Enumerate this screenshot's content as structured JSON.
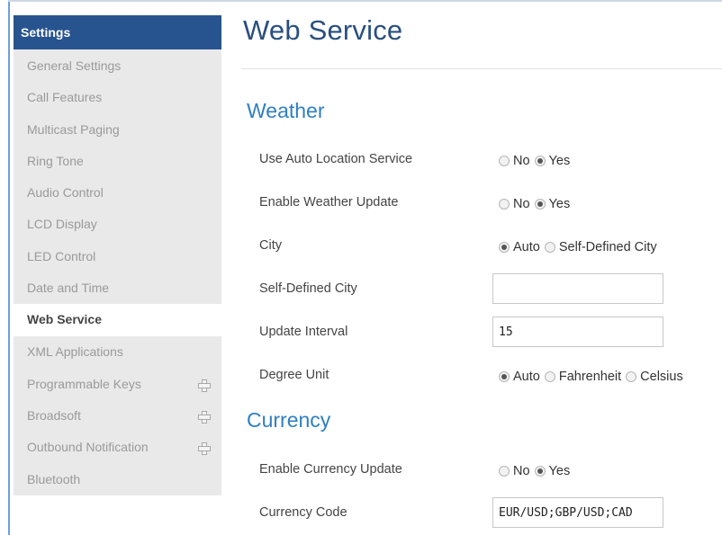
{
  "sidebar": {
    "header": "Settings",
    "items": [
      {
        "label": "General Settings"
      },
      {
        "label": "Call Features"
      },
      {
        "label": "Multicast Paging"
      },
      {
        "label": "Ring Tone"
      },
      {
        "label": "Audio Control"
      },
      {
        "label": "LCD Display"
      },
      {
        "label": "LED Control"
      },
      {
        "label": "Date and Time"
      },
      {
        "label": "Web Service",
        "active": true
      },
      {
        "label": "XML Applications"
      },
      {
        "label": "Programmable Keys",
        "expand_icon": "plus-icon"
      },
      {
        "label": "Broadsoft",
        "expand_icon": "plus-icon"
      },
      {
        "label": "Outbound Notification",
        "expand_icon": "plus-icon"
      },
      {
        "label": "Bluetooth"
      }
    ]
  },
  "main": {
    "title": "Web Service",
    "weather": {
      "title": "Weather",
      "auto_location": {
        "label": "Use Auto Location Service",
        "opt_no": "No",
        "opt_yes": "Yes",
        "selected": "Yes"
      },
      "weather_update": {
        "label": "Enable Weather Update",
        "opt_no": "No",
        "opt_yes": "Yes",
        "selected": "Yes"
      },
      "city": {
        "label": "City",
        "opt_auto": "Auto",
        "opt_self": "Self-Defined City",
        "selected": "Auto"
      },
      "self_defined_city": {
        "label": "Self-Defined City",
        "value": ""
      },
      "update_interval": {
        "label": "Update Interval",
        "value": "15"
      },
      "degree_unit": {
        "label": "Degree Unit",
        "opt_auto": "Auto",
        "opt_f": "Fahrenheit",
        "opt_c": "Celsius",
        "selected": "Auto"
      }
    },
    "currency": {
      "title": "Currency",
      "currency_update": {
        "label": "Enable Currency Update",
        "opt_no": "No",
        "opt_yes": "Yes",
        "selected": "Yes"
      },
      "currency_code": {
        "label": "Currency Code",
        "value": "EUR/USD;GBP/USD;CAD"
      }
    }
  },
  "colors": {
    "sidebar_header_bg": "#27548f",
    "sidebar_bg": "#e9e9e9",
    "title_color": "#2a4f7e",
    "section_color": "#2f7fc1"
  }
}
